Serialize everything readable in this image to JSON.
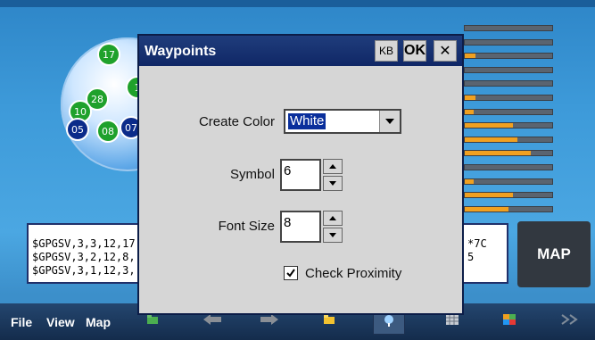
{
  "background": {
    "satellites": [
      {
        "id": "17",
        "color": "green"
      },
      {
        "id": "1",
        "color": "green"
      },
      {
        "id": "28",
        "color": "green"
      },
      {
        "id": "10",
        "color": "green"
      },
      {
        "id": "05",
        "color": "blue"
      },
      {
        "id": "08",
        "color": "green"
      },
      {
        "id": "07",
        "color": "blue"
      }
    ],
    "signal_levels": [
      0,
      0,
      0.12,
      0,
      0,
      0.12,
      0.1,
      0.55,
      0.6,
      0.75,
      0,
      0.1,
      0.55,
      0.5
    ],
    "nmea_lines": [
      "$GPGSV,3,3,12,17",
      "$GPGSV,3,2,12,8,",
      "$GPGSV,3,1,12,3,"
    ],
    "nmea_right_fragments": [
      "*7C",
      "5",
      ""
    ],
    "map_button_label": "MAP"
  },
  "taskbar": {
    "menu": [
      "File",
      "View",
      "Map"
    ],
    "icons": [
      "folder-icon",
      "arrow-left-icon",
      "arrow-right-icon",
      "open-folder-icon",
      "gps-icon",
      "grid-icon",
      "color-grid-icon",
      "chevron-right-icon"
    ]
  },
  "dialog": {
    "title": "Waypoints",
    "kb_label": "KB",
    "ok_label": "OK",
    "close_label": "✕",
    "create_color_label": "Create Color",
    "create_color_value": "White",
    "symbol_label": "Symbol",
    "symbol_value": "6",
    "font_size_label": "Font Size",
    "font_size_value": "8",
    "check_proximity_label": "Check Proximity",
    "check_proximity_checked": true
  },
  "colors": {
    "title_bar": "#102766",
    "dialog_bg": "#d6d6d6",
    "selection": "#0a2f9c",
    "signal_fill": "#f0a020"
  }
}
